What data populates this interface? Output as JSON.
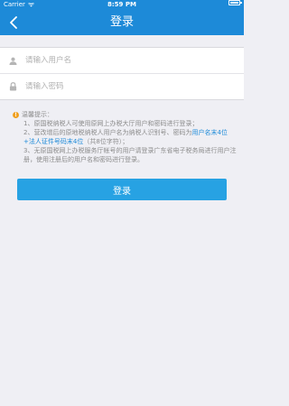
{
  "status": {
    "carrier": "Carrier",
    "time": "8:59 PM",
    "battery_level": 1.0
  },
  "navbar": {
    "back_icon": "chevron-left-icon",
    "title": "登录"
  },
  "form": {
    "username_placeholder": "请输入用户名",
    "password_placeholder": "请输入密码"
  },
  "tips": {
    "title": "温馨提示：",
    "line1": "1、原国税纳税人可使用原网上办税大厅用户和密码进行登录；",
    "line2a": "2、营改增后的原地税纳税人用户名为纳税人识别号、密码为",
    "line2b": "用户名末4位+法人证件号码末4位",
    "line2c": "（共8位字符）；",
    "line3": "3、无原国税网上办税服务厅帐号的用户请登录广东省电子税务局进行用户注册，使用注册后的用户名和密码进行登录。"
  },
  "login_button": "登录",
  "colors": {
    "brand": "#1d8ad8",
    "button": "#27a2e3",
    "background": "#efeff4"
  }
}
